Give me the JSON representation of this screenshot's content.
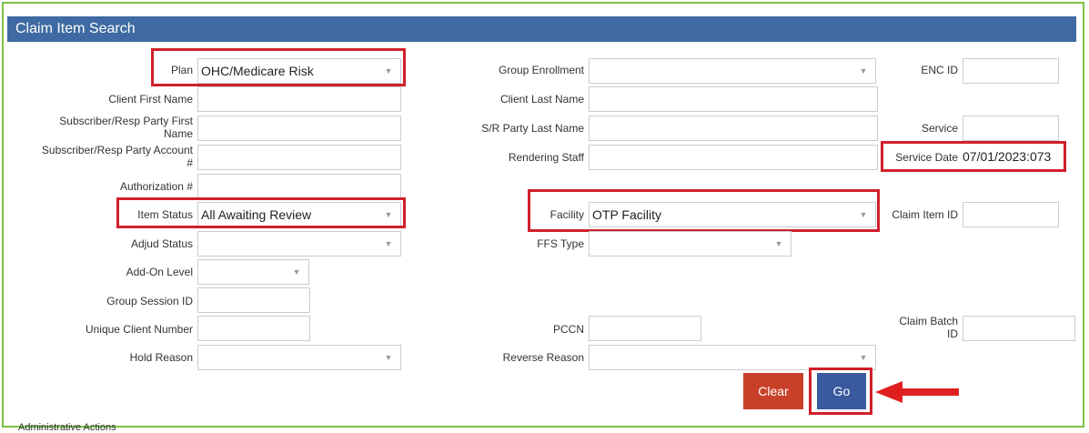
{
  "title": "Claim Item Search",
  "fields": {
    "plan": {
      "label": "Plan",
      "value": "OHC/Medicare Risk"
    },
    "group_enrollment": {
      "label": "Group Enrollment",
      "value": ""
    },
    "enc_id": {
      "label": "ENC ID",
      "value": ""
    },
    "client_first_name": {
      "label": "Client First Name",
      "value": ""
    },
    "client_last_name": {
      "label": "Client Last Name",
      "value": ""
    },
    "subscriber_first_name": {
      "label_line1": "Subscriber/Resp Party First",
      "label_line2": "Name",
      "value": ""
    },
    "sr_party_last_name": {
      "label": "S/R Party Last Name",
      "value": ""
    },
    "service": {
      "label": "Service",
      "value": ""
    },
    "subscriber_account": {
      "label_line1": "Subscriber/Resp Party Account",
      "label_line2": "#",
      "value": ""
    },
    "rendering_staff": {
      "label": "Rendering Staff",
      "value": ""
    },
    "service_date": {
      "label": "Service Date",
      "value": "07/01/2023:073"
    },
    "authorization": {
      "label": "Authorization #",
      "value": ""
    },
    "item_status": {
      "label": "Item Status",
      "value": "All Awaiting Review"
    },
    "facility": {
      "label": "Facility",
      "value": "OTP Facility"
    },
    "claim_item_id": {
      "label": "Claim Item ID",
      "value": ""
    },
    "adjud_status": {
      "label": "Adjud Status",
      "value": ""
    },
    "ffs_type": {
      "label": "FFS Type",
      "value": ""
    },
    "add_on_level": {
      "label": "Add-On Level",
      "value": ""
    },
    "group_session_id": {
      "label": "Group Session ID",
      "value": ""
    },
    "unique_client_number": {
      "label": "Unique Client Number",
      "value": ""
    },
    "pccn": {
      "label": "PCCN",
      "value": ""
    },
    "claim_batch_id": {
      "label_line1": "Claim Batch",
      "label_line2": "ID",
      "value": ""
    },
    "hold_reason": {
      "label": "Hold Reason",
      "value": ""
    },
    "reverse_reason": {
      "label": "Reverse Reason",
      "value": ""
    }
  },
  "buttons": {
    "clear": "Clear",
    "go": "Go"
  },
  "icons": {
    "dropdown": "chevron-down-icon",
    "pointer": "red-arrow-icon"
  },
  "colors": {
    "header": "#3f6aa3",
    "clear": "#c9402a",
    "go": "#3a5aa0",
    "highlight": "#d0202b",
    "frame": "#7cc142"
  },
  "footer_partial": "Administrative Actions"
}
